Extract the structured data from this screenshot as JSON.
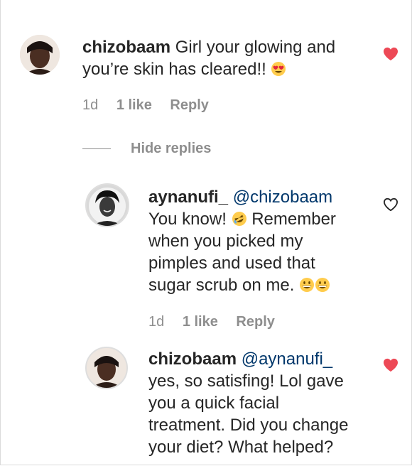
{
  "comments": [
    {
      "username": "chizobaam",
      "mention": "",
      "lines": [
        "Girl your glowing and",
        "you’re skin has cleared!!"
      ],
      "emoji": "heart-eyes-emoji",
      "time": "1d",
      "likes": "1 like",
      "reply_label": "Reply",
      "liked": true
    },
    {
      "username": "aynanufi_",
      "mention": "@chizobaam",
      "line1_prefix": "You know!",
      "line1_emoji": "rofl-emoji",
      "line1_suffix": "Remember",
      "lines": [
        "when you picked my",
        "pimples and used that",
        "sugar scrub on me."
      ],
      "end_emojis": [
        "grinning-emoji",
        "grinning-emoji"
      ],
      "time": "1d",
      "likes": "1 like",
      "reply_label": "Reply",
      "liked": false
    },
    {
      "username": "chizobaam",
      "mention": "@aynanufi_",
      "lines": [
        "yes, so satisfing! Lol gave",
        "you a quick facial",
        "treatment. Did you change",
        "your diet? What helped?"
      ],
      "liked": true
    }
  ],
  "hide_replies_label": "Hide replies",
  "colors": {
    "text": "#262626",
    "meta": "#8e8e8e",
    "mention": "#00376b",
    "heart_liked": "#ed4956",
    "heart_outline": "#262626"
  }
}
